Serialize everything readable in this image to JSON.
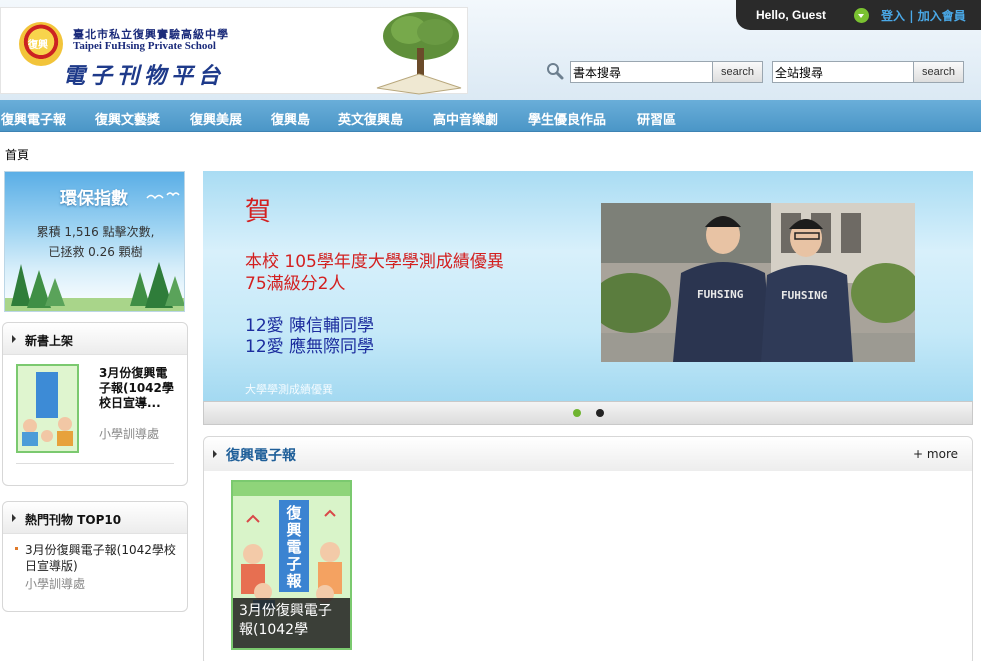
{
  "header": {
    "school_name_cn": "臺北市私立復興實驗高級中學",
    "school_name_en": "Taipei FuHsing Private School",
    "platform_title": "電子刊物平台",
    "emblem_text": "復興"
  },
  "userbar": {
    "greeting": "Hello, Guest",
    "login_label": "登入",
    "separator": "|",
    "register_label": "加入會員"
  },
  "search": {
    "book_search_value": "書本搜尋",
    "site_search_value": "全站搜尋",
    "button_label": "search"
  },
  "nav": {
    "items": [
      {
        "label": "復興電子報"
      },
      {
        "label": "復興文藝獎"
      },
      {
        "label": "復興美展"
      },
      {
        "label": "復興島"
      },
      {
        "label": "英文復興島"
      },
      {
        "label": "高中音樂劇"
      },
      {
        "label": "學生優良作品"
      },
      {
        "label": "研習區"
      }
    ]
  },
  "breadcrumb": "首頁",
  "eco": {
    "title": "環保指數",
    "line1": "累積 1,516 點擊次數,",
    "line2": "已拯救 0.26 顆樹"
  },
  "new_books": {
    "title": "新書上架",
    "book_title": "3月份復興電子報(1042學校日宣導...",
    "book_meta": "小學訓導處"
  },
  "top10": {
    "title": "熱門刊物 TOP10",
    "item_title": "3月份復興電子報(1042學校日宣導版)",
    "item_meta": "小學訓導處"
  },
  "banner": {
    "heading": "賀",
    "line1": "本校 105學年度大學學測成績優異",
    "line2": "75滿級分2人",
    "name1": "12愛 陳信輔同學",
    "name2": "12愛 應無際同學",
    "caption": "大學學測成績優異",
    "shirt_text": "FUHSING",
    "active_slide": 1,
    "slide_count": 2
  },
  "main_section": {
    "title": "復興電子報",
    "more_label": "+ more",
    "book_caption": "3月份復興電子報(1042學",
    "cover_title": "復興電子報"
  },
  "colors": {
    "nav_bg": "#4b96c7",
    "accent_link": "#4aa9e8",
    "banner_red": "#d32020",
    "banner_blue": "#1c2d9e",
    "section_title": "#1f5f99"
  }
}
